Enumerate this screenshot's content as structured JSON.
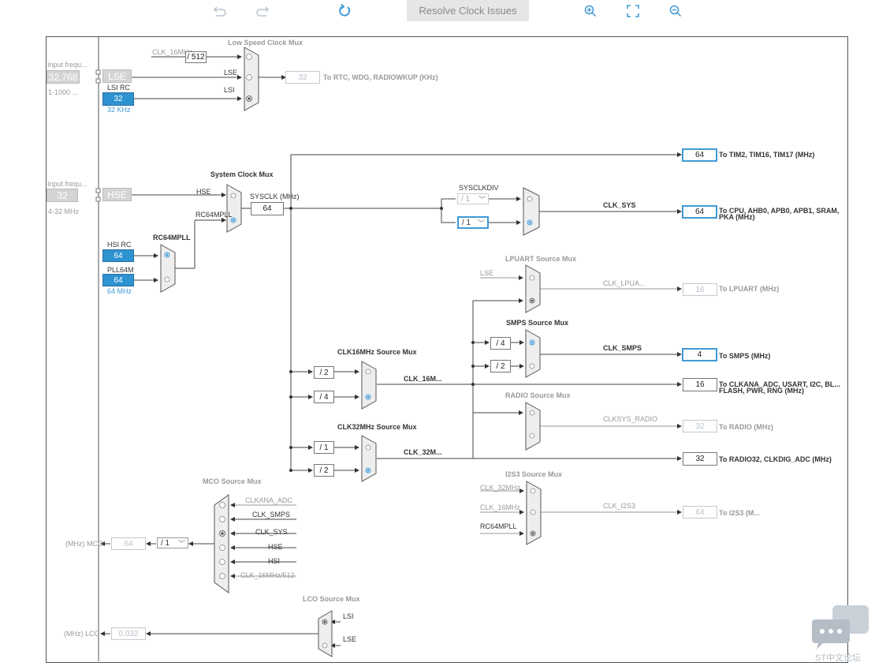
{
  "toolbar": {
    "resolve_label": "Resolve Clock Issues"
  },
  "inputs": {
    "lse_freq_label": "Input frequ...",
    "lse_freq_value": "32.768",
    "lse_range": "1-1000 ...",
    "lse_label": "LSE",
    "lsirc_label": "LSI RC",
    "lsirc_value": "32",
    "lsirc_unit": "32 KHz",
    "hse_freq_label": "Input frequ...",
    "hse_freq_value": "32",
    "hse_range": "4-32 MHz",
    "hse_label": "HSE",
    "hsirc_label": "HSI RC",
    "hsirc_value": "64",
    "hsirc_unit": "64 MHz",
    "pll64m_label": "PLL64M",
    "pll64m_value": "64",
    "pll64m_unit": "64 MHz"
  },
  "lowspeed": {
    "title": "Low Speed Clock Mux",
    "clk16_label": "CLK_16MHz",
    "div512": "/ 512",
    "lse": "LSE",
    "lsi": "LSI",
    "out_value": "32",
    "out_label": "To RTC, WDG, RADIOWKUP (KHz)"
  },
  "system": {
    "title": "System Clock Mux",
    "hse": "HSE",
    "rc64mpll": "RC64MPLL",
    "sysclk_label": "SYSCLK (MHz)",
    "sysclk_value": "64",
    "rc64mpll_mux": "RC64MPLL"
  },
  "sysclkdiv": {
    "title": "SYSCLKDIV",
    "div_top": "/ 1",
    "div_bottom": "/ 1",
    "clk_sys": "CLK_SYS",
    "out_value": "64",
    "out_label_1": "To CPU, AHB0, APB0, APB1, SRAM,",
    "out_label_2": "PKA (MHz)"
  },
  "tim": {
    "value": "64",
    "label": "To TIM2, TIM16, TIM17 (MHz)"
  },
  "lpuart": {
    "title": "LPUART Source Mux",
    "lse": "LSE",
    "clk": "CLK_LPUA...",
    "value": "16",
    "label": "To LPUART (MHz)"
  },
  "smps": {
    "title": "SMPS Source Mux",
    "div4": "/ 4",
    "div2": "/ 2",
    "clk": "CLK_SMPS",
    "value": "4",
    "label": "To SMPS (MHz)"
  },
  "clk16": {
    "title": "CLK16MHz Source Mux",
    "div2": "/ 2",
    "div4": "/ 4",
    "clk": "CLK_16M...",
    "value": "16",
    "label_1": "To CLKANA_ADC, USART, I2C, BL...",
    "label_2": "FLASH, PWR, RNG (MHz)"
  },
  "radio": {
    "title": "RADIO Source Mux",
    "clk": "CLKSYS_RADIO",
    "value": "32",
    "label": "To RADIO (MHz)"
  },
  "clk32": {
    "title": "CLK32MHz Source Mux",
    "div1": "/ 1",
    "div2": "/ 2",
    "clk": "CLK_32M...",
    "value": "32",
    "label": "To RADIO32, CLKDIG_ADC (MHz)"
  },
  "i2s3": {
    "title": "I2S3 Source Mux",
    "in1": "CLK_32MHz",
    "in2": "CLK_16MHz",
    "in3": "RC64MPLL",
    "clk": "CLK_I2S3",
    "value": "64",
    "label": "To I2S3 (M..."
  },
  "mco": {
    "title": "MCO Source Mux",
    "inputs": [
      "CLKANA_ADC",
      "CLK_SMPS",
      "CLK_SYS",
      "HSE",
      "HSI",
      "CLK_16MHz/512"
    ],
    "div": "/ 1",
    "value": "64",
    "label": "(MHz) MCO"
  },
  "lco": {
    "title": "LCO Source Mux",
    "lsi": "LSI",
    "lse": "LSE",
    "value": "0.032",
    "label": "(MHz) LCO"
  },
  "watermark": {
    "text": "ST中文论坛"
  }
}
